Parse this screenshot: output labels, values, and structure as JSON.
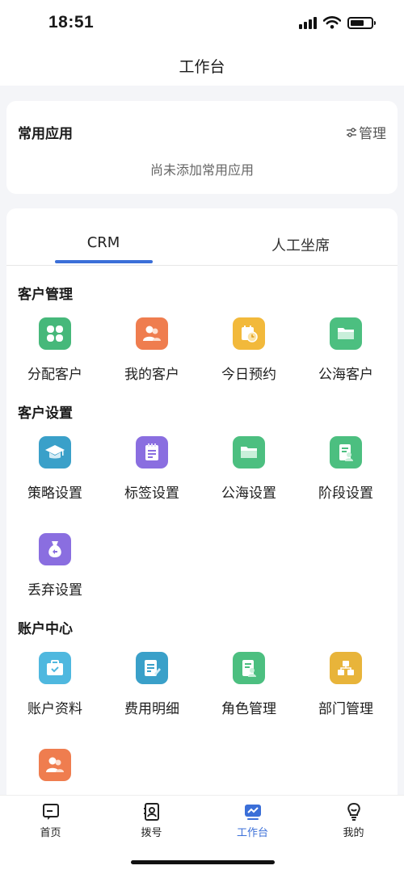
{
  "status": {
    "time": "18:51"
  },
  "nav": {
    "title": "工作台"
  },
  "common_apps": {
    "title": "常用应用",
    "manage": "管理",
    "empty": "尚未添加常用应用"
  },
  "tabs": [
    {
      "label": "CRM",
      "active": true
    },
    {
      "label": "人工坐席",
      "active": false
    }
  ],
  "sections": {
    "customer_mgmt": {
      "title": "客户管理",
      "items": [
        {
          "label": "分配客户",
          "icon": "clover-icon",
          "color": "#46b87a"
        },
        {
          "label": "我的客户",
          "icon": "users-icon",
          "color": "#ef7d4f"
        },
        {
          "label": "今日预约",
          "icon": "calendar-clock-icon",
          "color": "#f2b93b"
        },
        {
          "label": "公海客户",
          "icon": "folder-icon",
          "color": "#4cbf80"
        }
      ]
    },
    "customer_settings": {
      "title": "客户设置",
      "items": [
        {
          "label": "策略设置",
          "icon": "graduation-cap-icon",
          "color": "#3aa0c9"
        },
        {
          "label": "标签设置",
          "icon": "notepad-icon",
          "color": "#8a6ee0"
        },
        {
          "label": "公海设置",
          "icon": "folder-icon",
          "color": "#4cbf80"
        },
        {
          "label": "阶段设置",
          "icon": "id-document-icon",
          "color": "#4cbf80"
        },
        {
          "label": "丢弃设置",
          "icon": "money-bag-icon",
          "color": "#8a6ee0"
        }
      ]
    },
    "account_center": {
      "title": "账户中心",
      "items": [
        {
          "label": "账户资料",
          "icon": "briefcase-check-icon",
          "color": "#4fb8df"
        },
        {
          "label": "费用明细",
          "icon": "receipt-edit-icon",
          "color": "#3aa0c9"
        },
        {
          "label": "角色管理",
          "icon": "id-document-icon",
          "color": "#4cbf80"
        },
        {
          "label": "部门管理",
          "icon": "org-chart-icon",
          "color": "#e8b43a"
        },
        {
          "label": "",
          "icon": "users-icon",
          "color": "#ef7d4f"
        }
      ]
    }
  },
  "tabbar": [
    {
      "label": "首页",
      "icon": "message-square-icon",
      "active": false
    },
    {
      "label": "拨号",
      "icon": "dial-contact-icon",
      "active": false
    },
    {
      "label": "工作台",
      "icon": "workbench-chart-icon",
      "active": true
    },
    {
      "label": "我的",
      "icon": "lightbulb-icon",
      "active": false
    }
  ],
  "colors": {
    "accent": "#3b6fd8",
    "background": "#f4f5f8"
  }
}
